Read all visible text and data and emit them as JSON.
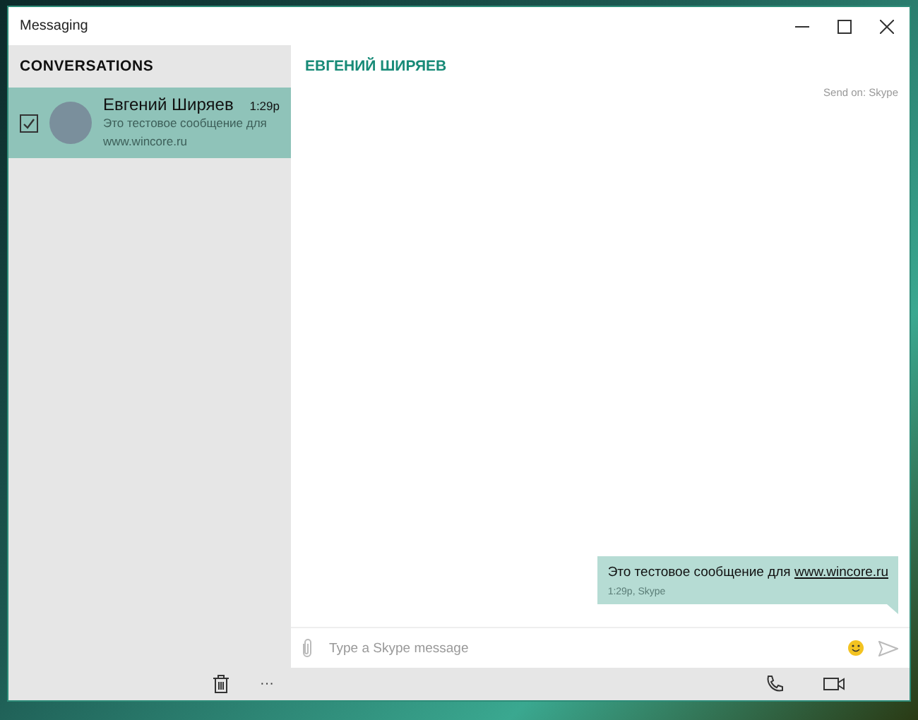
{
  "window": {
    "title": "Messaging"
  },
  "sidebar": {
    "title": "CONVERSATIONS",
    "conversations": [
      {
        "name": "Евгений Ширяев",
        "time": "1:29p",
        "preview": "Это тестовое сообщение для www.wincore.ru",
        "checked": true,
        "selected": true
      }
    ],
    "toolbar": {
      "more": "···"
    }
  },
  "chat": {
    "title": "ЕВГЕНИЙ ШИРЯЕВ",
    "send_on": "Send on: Skype",
    "messages": [
      {
        "text_before": "Это тестовое сообщение для ",
        "link": "www.wincore.ru",
        "meta": "1:29p, Skype"
      }
    ],
    "input": {
      "placeholder": "Type a Skype message"
    }
  }
}
